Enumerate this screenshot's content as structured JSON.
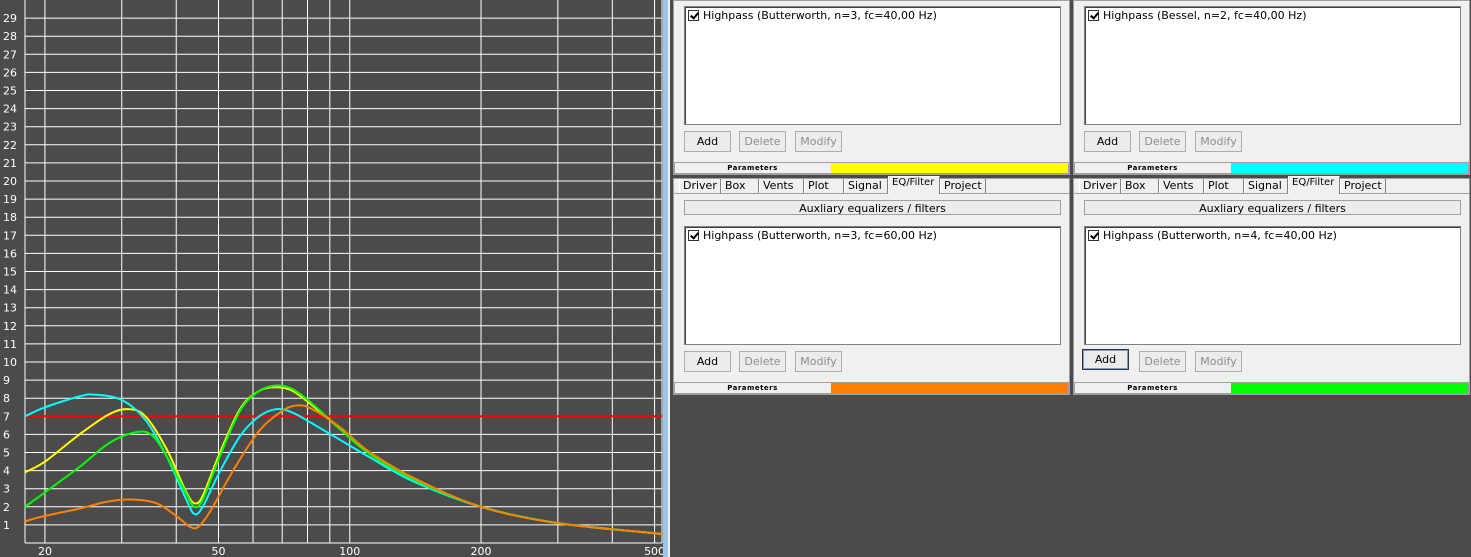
{
  "chart_data": {
    "type": "line",
    "x_scale": "log",
    "xlim": [
      18,
      520
    ],
    "ylim": [
      0,
      30
    ],
    "x_ticks": [
      20,
      50,
      100,
      200,
      500
    ],
    "y_ticks": [
      1,
      2,
      3,
      4,
      5,
      6,
      7,
      8,
      9,
      10,
      11,
      12,
      13,
      14,
      15,
      16,
      17,
      18,
      19,
      20,
      21,
      22,
      23,
      24,
      25,
      26,
      27,
      28,
      29
    ],
    "grid": true,
    "reference_line": {
      "y": 7,
      "color": "#ff0000"
    },
    "series": [
      {
        "color": "#ffff00",
        "points": [
          [
            18,
            3.9
          ],
          [
            20,
            4.5
          ],
          [
            24,
            6.0
          ],
          [
            28,
            7.1
          ],
          [
            31,
            7.4
          ],
          [
            34,
            7.0
          ],
          [
            38,
            5.2
          ],
          [
            42,
            2.9
          ],
          [
            44,
            2.2
          ],
          [
            46,
            2.6
          ],
          [
            50,
            4.8
          ],
          [
            56,
            7.4
          ],
          [
            62,
            8.4
          ],
          [
            68,
            8.6
          ],
          [
            74,
            8.4
          ],
          [
            82,
            7.6
          ],
          [
            95,
            6.3
          ],
          [
            110,
            5.0
          ],
          [
            140,
            3.5
          ],
          [
            200,
            2.0
          ],
          [
            300,
            1.1
          ],
          [
            520,
            0.5
          ]
        ]
      },
      {
        "color": "#00ffff",
        "points": [
          [
            18,
            7.0
          ],
          [
            20,
            7.5
          ],
          [
            24,
            8.1
          ],
          [
            26,
            8.2
          ],
          [
            30,
            7.9
          ],
          [
            34,
            6.8
          ],
          [
            38,
            4.8
          ],
          [
            42,
            2.5
          ],
          [
            44,
            1.6
          ],
          [
            46,
            2.0
          ],
          [
            50,
            3.8
          ],
          [
            56,
            5.9
          ],
          [
            62,
            7.0
          ],
          [
            68,
            7.4
          ],
          [
            74,
            7.2
          ],
          [
            82,
            6.6
          ],
          [
            95,
            5.7
          ],
          [
            110,
            4.8
          ],
          [
            140,
            3.4
          ],
          [
            200,
            2.0
          ],
          [
            300,
            1.1
          ],
          [
            520,
            0.5
          ]
        ]
      },
      {
        "color": "#00ff00",
        "points": [
          [
            18,
            2.0
          ],
          [
            20,
            2.8
          ],
          [
            24,
            4.2
          ],
          [
            28,
            5.5
          ],
          [
            32,
            6.1
          ],
          [
            35,
            6.0
          ],
          [
            38,
            4.8
          ],
          [
            42,
            2.8
          ],
          [
            44,
            2.0
          ],
          [
            46,
            2.4
          ],
          [
            50,
            4.6
          ],
          [
            56,
            7.3
          ],
          [
            62,
            8.4
          ],
          [
            68,
            8.7
          ],
          [
            74,
            8.5
          ],
          [
            82,
            7.7
          ],
          [
            95,
            6.3
          ],
          [
            110,
            5.0
          ],
          [
            140,
            3.5
          ],
          [
            200,
            2.0
          ],
          [
            300,
            1.1
          ],
          [
            520,
            0.5
          ]
        ]
      },
      {
        "color": "#ff8000",
        "points": [
          [
            18,
            1.2
          ],
          [
            20,
            1.5
          ],
          [
            24,
            1.9
          ],
          [
            28,
            2.3
          ],
          [
            32,
            2.4
          ],
          [
            36,
            2.2
          ],
          [
            40,
            1.5
          ],
          [
            43,
            0.9
          ],
          [
            45,
            0.9
          ],
          [
            48,
            1.8
          ],
          [
            54,
            4.0
          ],
          [
            62,
            6.2
          ],
          [
            70,
            7.3
          ],
          [
            76,
            7.6
          ],
          [
            82,
            7.4
          ],
          [
            95,
            6.4
          ],
          [
            110,
            5.1
          ],
          [
            140,
            3.6
          ],
          [
            200,
            2.0
          ],
          [
            300,
            1.1
          ],
          [
            520,
            0.5
          ]
        ]
      }
    ]
  },
  "panels": [
    {
      "filter": "Highpass (Butterworth, n=3, fc=40,00 Hz)",
      "buttons": {
        "add": "Add",
        "delete": "Delete",
        "modify": "Modify"
      },
      "parameters_label": "Parameters",
      "color": "#ffff00"
    },
    {
      "filter": "Highpass (Bessel, n=2, fc=40,00 Hz)",
      "buttons": {
        "add": "Add",
        "delete": "Delete",
        "modify": "Modify"
      },
      "parameters_label": "Parameters",
      "color": "#00ffff"
    },
    {
      "tabs": [
        "Driver",
        "Box",
        "Vents",
        "Plot",
        "Signal",
        "EQ/Filter",
        "Project"
      ],
      "aux_title": "Auxliary equalizers / filters",
      "filter": "Highpass (Butterworth, n=3, fc=60,00 Hz)",
      "buttons": {
        "add": "Add",
        "delete": "Delete",
        "modify": "Modify"
      },
      "parameters_label": "Parameters",
      "color": "#ff8000"
    },
    {
      "tabs": [
        "Driver",
        "Box",
        "Vents",
        "Plot",
        "Signal",
        "EQ/Filter",
        "Project"
      ],
      "aux_title": "Auxliary equalizers / filters",
      "filter": "Highpass (Butterworth, n=4, fc=40,00 Hz)",
      "buttons": {
        "add": "Add",
        "delete": "Delete",
        "modify": "Modify"
      },
      "parameters_label": "Parameters",
      "color": "#00ff00"
    }
  ]
}
